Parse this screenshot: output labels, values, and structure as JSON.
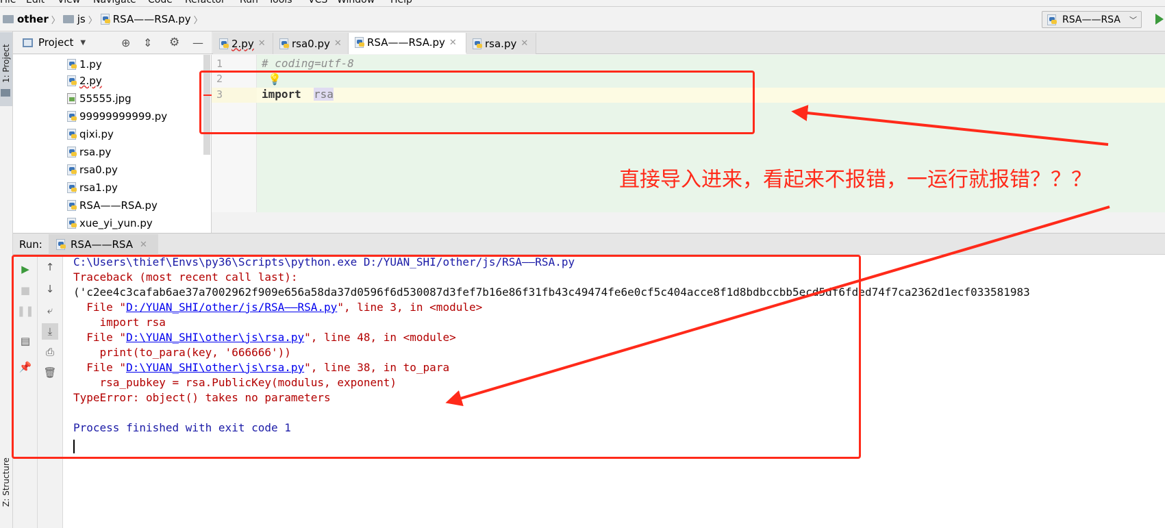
{
  "menu": [
    "File",
    "Edit",
    "View",
    "Navigate",
    "Code",
    "Refactor",
    "Run",
    "Tools",
    "VCS",
    "Window",
    "Help"
  ],
  "breadcrumb": {
    "root": "other",
    "folder": "js",
    "file": "RSA——RSA.py"
  },
  "run_config": {
    "label": "RSA——RSA"
  },
  "left_strip": {
    "project_tab": "1: Project",
    "structure_tab": "Z: Structure"
  },
  "project_panel": {
    "title": "Project",
    "files": [
      "1.py",
      "2.py",
      "55555.jpg",
      "99999999999.py",
      "qixi.py",
      "rsa.py",
      "rsa0.py",
      "rsa1.py",
      "RSA——RSA.py",
      "xue_yi_yun.py"
    ]
  },
  "editor": {
    "tabs": [
      "2.py",
      "rsa0.py",
      "RSA——RSA.py",
      "rsa.py"
    ],
    "active_tab": "RSA——RSA.py",
    "line_numbers": [
      "1",
      "2",
      "3"
    ],
    "lines": {
      "l1": "# coding=utf-8",
      "l3_keyword": "import",
      "l3_module": "rsa"
    }
  },
  "run_panel": {
    "label": "Run:",
    "tab": "RSA——RSA",
    "console": {
      "cmd": "C:\\Users\\thief\\Envs\\py36\\Scripts\\python.exe D:/YUAN_SHI/other/js/RSA——RSA.py",
      "traceback": "Traceback (most recent call last):",
      "tuple_line": "('c2ee4c3cafab6ae37a7002962f909e656a58da37d0596f6d530087d3fef7b16e86f31fb43c49474fe6e0cf5c404acce8f1d8bdbccbb5ecd5df6fded74f7ca2362d1ecf033581983",
      "f1_pre": "  File \"",
      "f1_link": "D:/YUAN_SHI/other/js/RSA——RSA.py",
      "f1_post": "\", line 3, in <module>",
      "f1_code": "    import rsa",
      "f2_pre": "  File \"",
      "f2_link": "D:\\YUAN_SHI\\other\\js\\rsa.py",
      "f2_post": "\", line 48, in <module>",
      "f2_code": "    print(to_para(key, '666666'))",
      "f3_pre": "  File \"",
      "f3_link": "D:\\YUAN_SHI\\other\\js\\rsa.py",
      "f3_post": "\", line 38, in to_para",
      "f3_code": "    rsa_pubkey = rsa.PublicKey(modulus, exponent)",
      "error": "TypeError: object() takes no parameters",
      "exit": "Process finished with exit code 1"
    }
  },
  "annotation": {
    "text": "直接导入进来，看起来不报错，一运行就报错？？？",
    "color": "#ff2a1a"
  }
}
